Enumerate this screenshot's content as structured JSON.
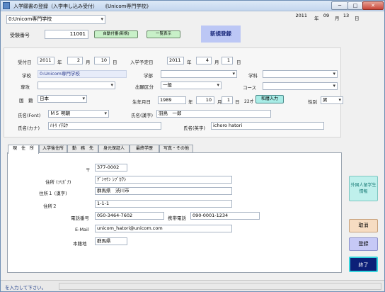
{
  "window": {
    "title": "入学願書の登録（入学申し込み受付）　　《Unicom専門学校》",
    "minimize": "─",
    "maximize": "□",
    "close": "✕"
  },
  "header": {
    "school_select": "0:Unicom専門学校",
    "date_year": "2011",
    "date_year_unit": "年",
    "date_month": "09",
    "date_month_unit": "月",
    "date_day": "13",
    "date_day_unit": "日",
    "exam_no_label": "受験番号",
    "exam_no_value": "11001",
    "auto_number_button": "自動付番(新規)",
    "list_button": "一覧表示",
    "mode_badge": "新規登録"
  },
  "form": {
    "received_label": "受付日",
    "received_year": "2011",
    "received_month": "2",
    "received_day": "10",
    "year_unit": "年",
    "month_unit": "月",
    "day_unit": "日",
    "planned_label": "入学予定日",
    "planned_year": "2011",
    "planned_month": "4",
    "planned_day": "1",
    "school_label": "学校",
    "school_value": "0:Unicom専門学校",
    "faculty_label": "学部",
    "faculty_value": "",
    "department_label": "学科",
    "department_value": "",
    "major_label": "専攻",
    "major_value": "",
    "enroll_type_label": "出願区分",
    "enroll_type_value": "一般",
    "course_label": "コース",
    "course_value": "",
    "nationality_label": "国　籍",
    "nationality_value": "日本",
    "birth_label": "生年月日",
    "birth_year": "1989",
    "birth_month": "10",
    "birth_day": "1",
    "age": "22才",
    "era_button": "和暦入力",
    "gender_label": "性別",
    "gender_value": "男",
    "font_label": "氏名(Font)",
    "font_value": "ＭＳ 明朝",
    "kanji_name_label": "氏名(漢字)",
    "kanji_name_value": "羽鳥　一郎",
    "kana_label": "氏名(カナ)",
    "kana_value": "ﾊﾄﾘ ｲﾁﾛｳ",
    "roman_label": "氏名(英字)",
    "roman_value": "ichoro hatori"
  },
  "tabs": [
    {
      "label": "現　住　所"
    },
    {
      "label": "入学後住所"
    },
    {
      "label": "勤　務　先"
    },
    {
      "label": "身元保証人"
    },
    {
      "label": "最終学歴"
    },
    {
      "label": "写真・その他"
    }
  ],
  "address": {
    "postal_label": "〒",
    "postal_value": "377-0002",
    "kana_label": "住所 (ﾌﾘｶﾞﾅ)",
    "kana_value": "ｸﾞﾝﾏｹﾝ ｼﾌﾞｶﾜｼ",
    "addr1_label": "住所１ (漢字)",
    "addr1_value": "群馬県　渋川市",
    "addr2_label": "住所２",
    "addr2_value": "1-1-1",
    "phone_label": "電話番号",
    "phone_value": "050-3464-7602",
    "mobile_label": "携帯電話",
    "mobile_value": "090-0001-1234",
    "email_label": "E-Mail",
    "email_value": "unicom_hatori@unicom.com",
    "domicile_label": "本籍地",
    "domicile_value": "群馬県"
  },
  "side_buttons": {
    "foreign": "外国人留学生情報",
    "cancel": "取消",
    "register": "登録",
    "exit": "終了"
  },
  "status": {
    "message": "を入力して下さい。"
  },
  "colors": {
    "mode_badge_bg": "#bcc7f5",
    "auto_btn_bg": "#c8f0c8",
    "list_btn_bg": "#c8f0c8",
    "era_btn_bg": "#a8ece6",
    "foreign_btn_bg": "#bff0ec",
    "cancel_btn_bg": "#f6dcc2",
    "register_btn_bg": "#c6c9f6",
    "exit_btn_bg": "#0c1f78"
  }
}
